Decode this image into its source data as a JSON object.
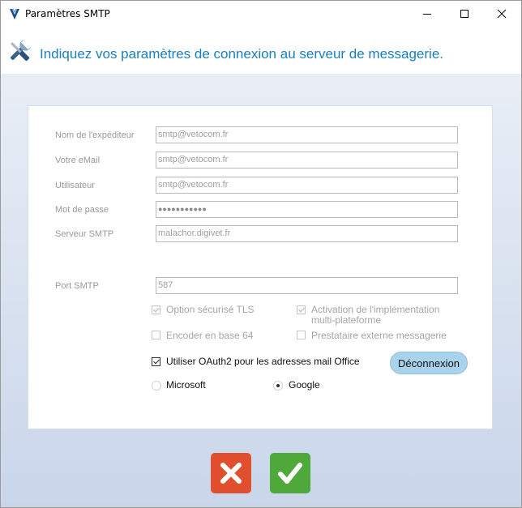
{
  "window": {
    "title": "Paramètres SMTP",
    "controls": [
      "minimize-icon",
      "maximize-icon",
      "close-icon"
    ]
  },
  "header": {
    "icon": "tools-icon",
    "text": "Indiquez vos paramètres de connexion au serveur de messagerie."
  },
  "form": {
    "sender_name": {
      "label": "Nom de l'expéditeur",
      "value": "smtp@vetocom.fr"
    },
    "email": {
      "label": "Votre eMail",
      "value": "smtp@vetocom.fr"
    },
    "user": {
      "label": "Utilisateur",
      "value": "smtp@vetocom.fr"
    },
    "password": {
      "label": "Mot de passe",
      "value": "●●●●●●●●●●●"
    },
    "server": {
      "label": "Serveur SMTP",
      "value": "malachor.digivet.fr"
    },
    "port": {
      "label": "Port SMTP",
      "value": "587"
    }
  },
  "options": {
    "tls": {
      "label": "Option sécurisé TLS",
      "checked": true
    },
    "multiplatform": {
      "label_line1": "Activation de l'implémentation",
      "label_line2": "multi-plateforme",
      "checked": true
    },
    "base64": {
      "label": "Encoder en base 64",
      "checked": false
    },
    "external_provider": {
      "label": "Prestataire externe messagerie",
      "checked": false
    },
    "oauth2": {
      "label": "Utiliser OAuth2 pour les adresses mail Office",
      "checked": true
    }
  },
  "disconnect_label": "Déconnexion",
  "providers": {
    "microsoft": {
      "label": "Microsoft",
      "selected": false
    },
    "google": {
      "label": "Google",
      "selected": true
    }
  },
  "buttons": {
    "cancel": {
      "icon": "x-icon",
      "color": "#e0502e"
    },
    "ok": {
      "icon": "checkmark-icon",
      "color": "#4fa83a"
    }
  },
  "colors": {
    "accent": "#1a7fc0"
  }
}
